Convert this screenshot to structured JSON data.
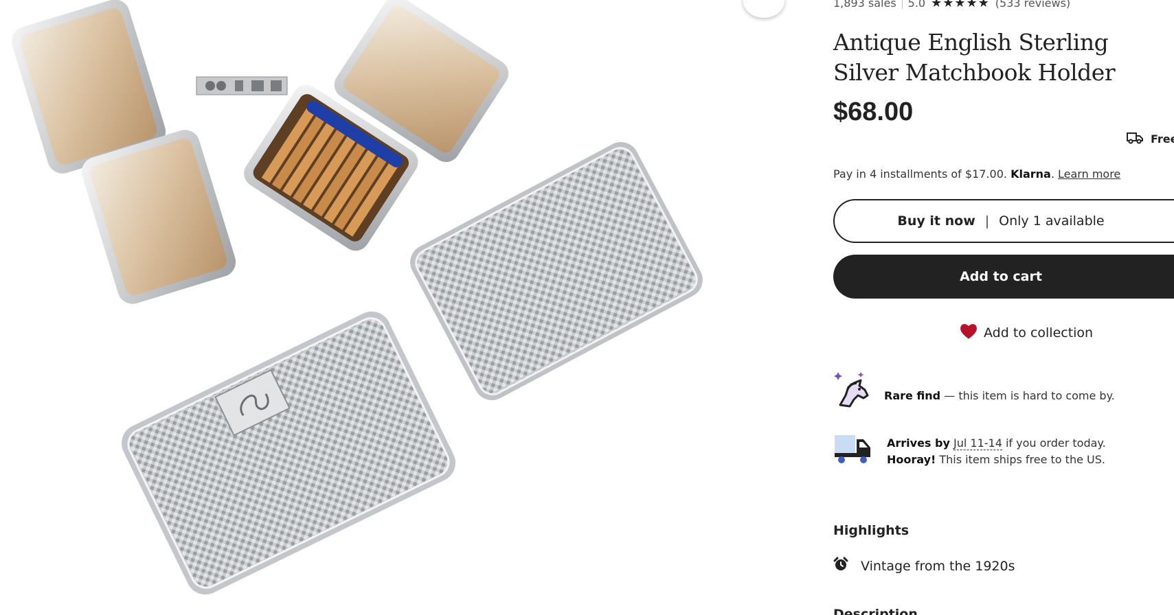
{
  "listing": {
    "sales": "1,893 sales",
    "rating": "5.0",
    "stars": "★★★★★",
    "reviews": "(533 reviews)",
    "title": "Antique English Sterling Silver Matchbook Holder",
    "price": "$68.00",
    "shipping_badge": "Free"
  },
  "payment": {
    "installments_text": "Pay in 4 installments of $17.00.",
    "provider": "Klarna",
    "learn_more": "Learn more"
  },
  "actions": {
    "buy_now_label": "Buy it now",
    "buy_now_divider": "|",
    "availability": "Only 1 available",
    "add_to_cart_label": "Add to cart",
    "add_to_collection_label": "Add to collection"
  },
  "features": {
    "rare_title": "Rare find",
    "rare_text": " — this item is hard to come by.",
    "arrives_label": "Arrives by",
    "arrives_date": "Jul 11-14",
    "arrives_suffix": " if you order today.",
    "hooray_label": "Hooray!",
    "hooray_text": " This item ships free to the US."
  },
  "highlights": {
    "title": "Highlights",
    "items": [
      "Vintage from the 1920s"
    ]
  },
  "next_section_title": "Description",
  "icons": {
    "favorite": "heart-outline-icon",
    "shipping": "truck-icon",
    "collection": "heart-filled-icon",
    "rare": "unicorn-icon",
    "delivery": "delivery-truck-icon",
    "vintage": "alarm-clock-icon"
  },
  "colors": {
    "primary_button": "#222222",
    "collection_heart": "#b7102b",
    "accent_purple": "#7b4fb3",
    "truck_blue": "#3f5fbf"
  }
}
